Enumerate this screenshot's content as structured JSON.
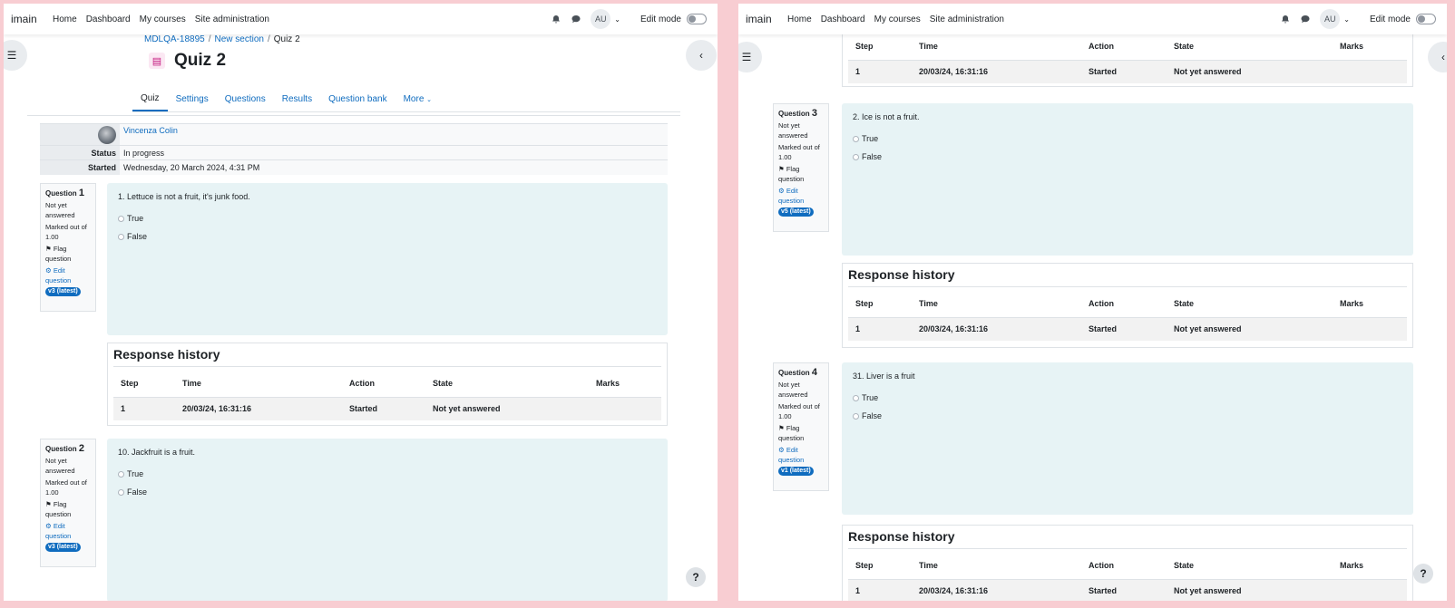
{
  "nav": {
    "brand": "imain",
    "links": [
      "Home",
      "Dashboard",
      "My courses",
      "Site administration"
    ],
    "user_initials": "AU",
    "edit_mode_label": "Edit mode"
  },
  "breadcrumb": {
    "items": [
      "MDLQA-18895",
      "New section",
      "Quiz 2"
    ]
  },
  "page_title": "Quiz 2",
  "tabs": [
    "Quiz",
    "Settings",
    "Questions",
    "Results",
    "Question bank",
    "More"
  ],
  "summary": {
    "user_name": "Vincenza Colin",
    "status_label": "Status",
    "status_value": "In progress",
    "started_label": "Started",
    "started_value": "Wednesday, 20 March 2024, 4:31 PM"
  },
  "questions": [
    {
      "label": "Question",
      "number": "1",
      "state": "Not yet answered",
      "marks": "Marked out of 1.00",
      "flag": "Flag question",
      "edit": "Edit question",
      "version": "v3 (latest)",
      "text": "1. Lettuce is not a fruit, it's junk food.",
      "options": [
        "True",
        "False"
      ]
    },
    {
      "label": "Question",
      "number": "2",
      "state": "Not yet answered",
      "marks": "Marked out of 1.00",
      "flag": "Flag question",
      "edit": "Edit question",
      "version": "v3 (latest)",
      "text": "10. Jackfruit is a fruit.",
      "options": [
        "True",
        "False"
      ]
    },
    {
      "label": "Question",
      "number": "3",
      "state": "Not yet answered",
      "marks": "Marked out of 1.00",
      "flag": "Flag question",
      "edit": "Edit question",
      "version": "v5 (latest)",
      "text": "2. Ice is not a fruit.",
      "options": [
        "True",
        "False"
      ]
    },
    {
      "label": "Question",
      "number": "4",
      "state": "Not yet answered",
      "marks": "Marked out of 1.00",
      "flag": "Flag question",
      "edit": "Edit question",
      "version": "v1 (latest)",
      "text": "31. Liver is a fruit",
      "options": [
        "True",
        "False"
      ]
    }
  ],
  "response_history": {
    "title": "Response history",
    "headers": [
      "Step",
      "Time",
      "Action",
      "State",
      "Marks"
    ],
    "row": [
      "1",
      "20/03/24, 16:31:16",
      "Started",
      "Not yet answered",
      ""
    ]
  },
  "help_label": "?"
}
